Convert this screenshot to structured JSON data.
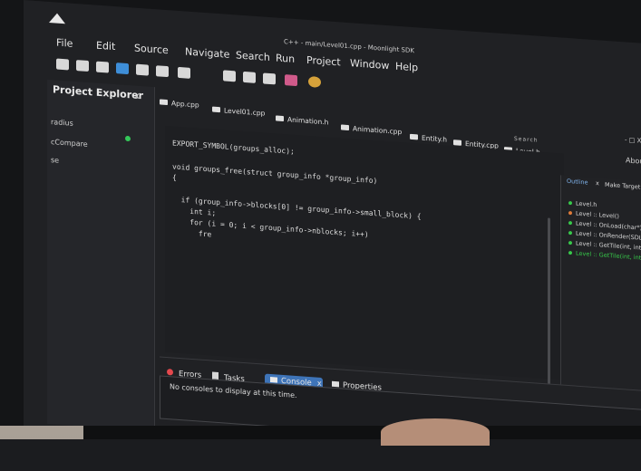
{
  "window": {
    "title": "C++ - main/Level01.cpp - Moonlight SDK"
  },
  "menubar": [
    "File",
    "Edit",
    "Source",
    "Navigate",
    "Search",
    "Run",
    "Project",
    "Window",
    "Help"
  ],
  "explorer": {
    "title": "Project Explorer",
    "close": "x",
    "items": [
      "radius",
      "cCompare",
      "se"
    ]
  },
  "tabs": [
    "App.cpp",
    "Level01.cpp",
    "Animation.h",
    "Animation.cpp",
    "Entity.h",
    "Entity.cpp",
    "Level.h"
  ],
  "tabs_close": "X",
  "search_hint": "Search",
  "window_controls": "- □ X",
  "about": "About",
  "editor_lines": [
    "EXPORT_SYMBOL(groups_alloc);",
    "",
    "void groups_free(struct group_info *group_info)",
    "{",
    "",
    "  if (group_info->blocks[0] != group_info->small_block) {",
    "    int i;",
    "    for (i = 0; i < group_info->nblocks; i++)",
    "      fre"
  ],
  "outline": {
    "tabs": [
      "Outline",
      "x",
      "Make Target"
    ],
    "items": [
      {
        "label": "Level.h",
        "color": "#37c84a"
      },
      {
        "label": "Level :: Level()",
        "color": "#e07b39"
      },
      {
        "label": "Level :: OnLoad(char*)",
        "color": "#37c84a"
      },
      {
        "label": "Level :: OnRender(SDL_Int",
        "color": "#37c84a"
      },
      {
        "label": "Level :: GetTile(int, int)",
        "color": "#37c84a"
      },
      {
        "label": "Level :: GetTile(int, int)",
        "color": "#37c84a"
      }
    ]
  },
  "bottom_tabs": {
    "errors": "Errors",
    "tasks": "Tasks",
    "console": "Console",
    "console_close": "x",
    "properties": "Properties"
  },
  "console_message": "No consoles to display at this time.",
  "colors": {
    "accent": "#3e74b8",
    "ok": "#34c759",
    "error": "#e5484d"
  }
}
